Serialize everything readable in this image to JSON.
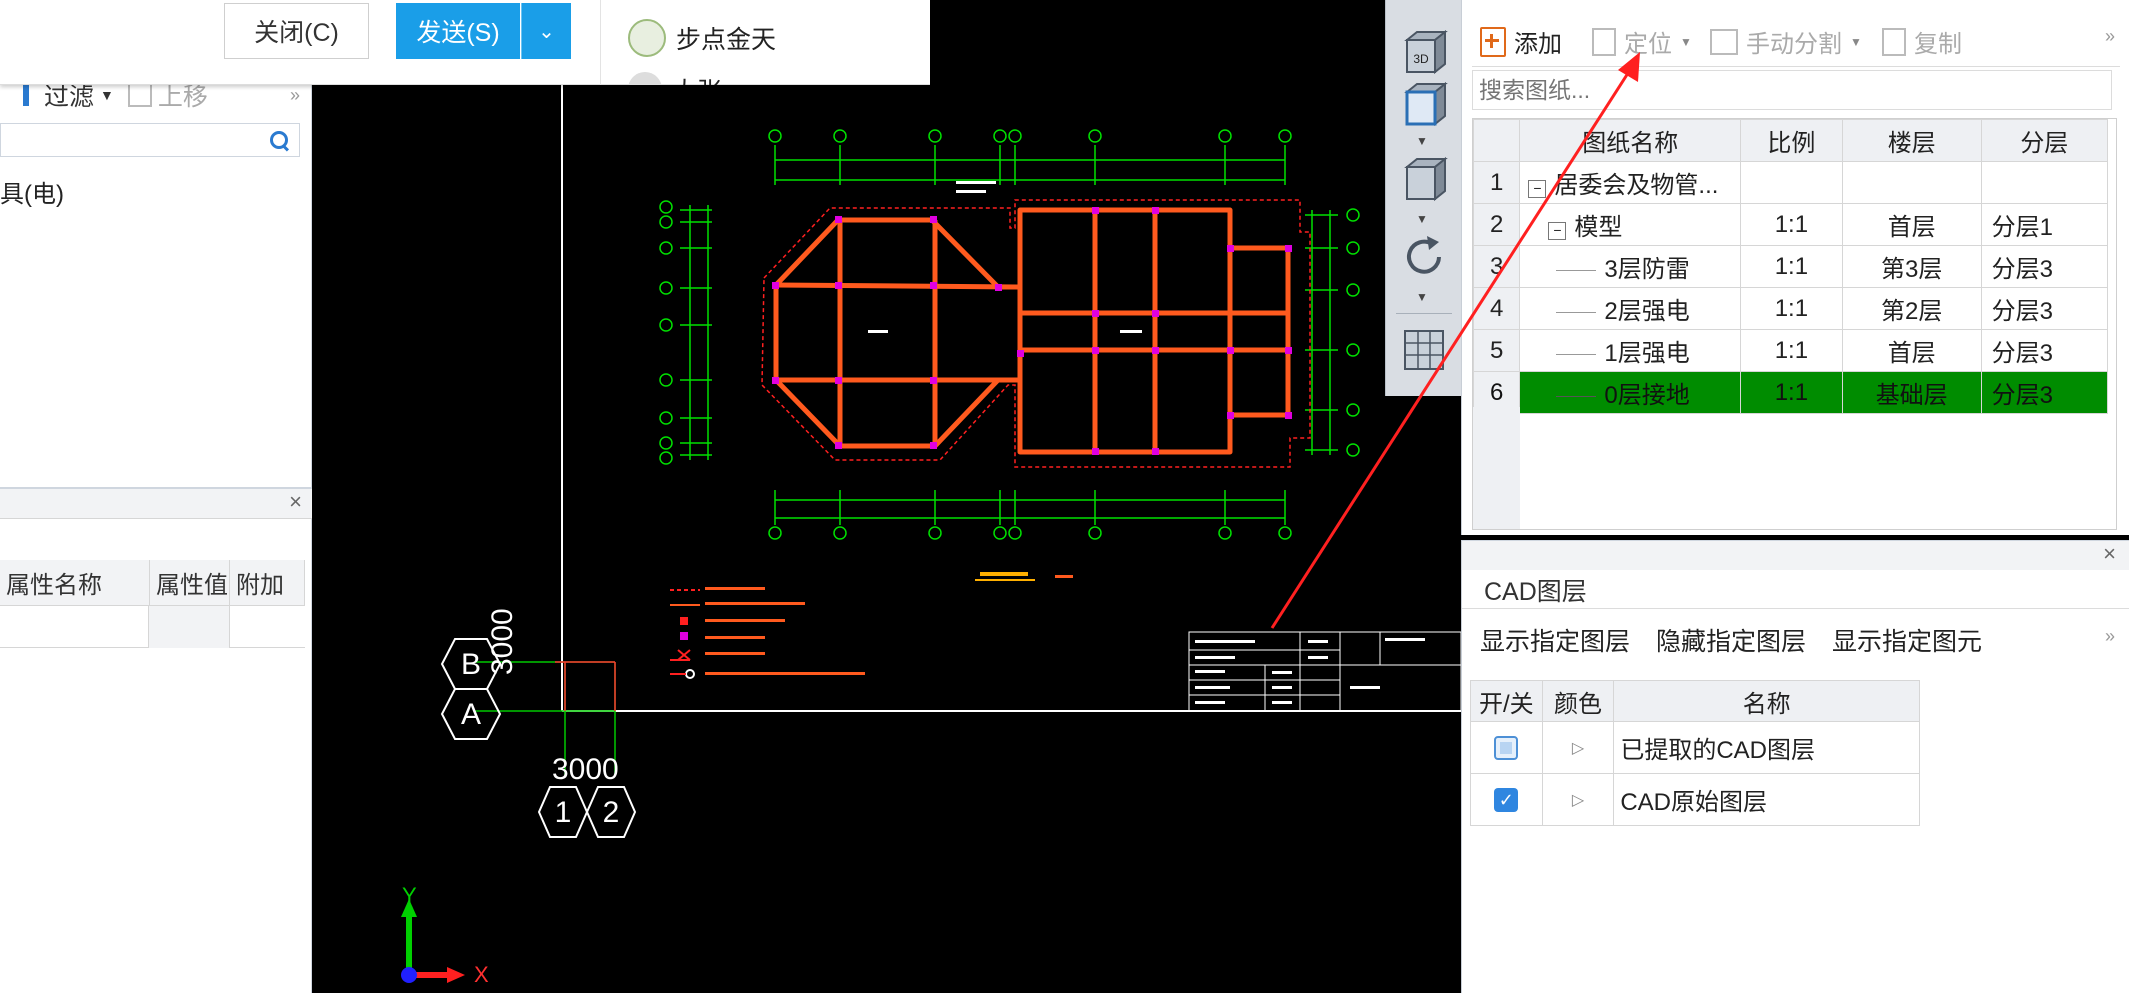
{
  "dialog": {
    "close_label": "关闭(C)",
    "send_label": "发送(S)",
    "contacts": [
      {
        "name": "步点金天"
      },
      {
        "name": "大张"
      }
    ]
  },
  "left_panel": {
    "toolbar": {
      "filter_label": "过滤",
      "moveup_label": "上移"
    },
    "tree_item": "具(电)",
    "properties": {
      "headers": [
        "属性名称",
        "属性值",
        "附加"
      ]
    }
  },
  "canvas": {
    "axis_labels": {
      "row_b": "B",
      "row_a": "A",
      "col_1": "1",
      "col_2": "2",
      "dim_horizontal": "3000",
      "dim_vertical": "3000"
    },
    "ucs": {
      "x_label": "X",
      "y_label": "Y"
    }
  },
  "view_toolbar": {
    "button_3d_label": "3D"
  },
  "drawing_panel": {
    "toolbar": {
      "add_label": "添加",
      "locate_label": "定位",
      "split_label": "手动分割",
      "copy_label": "复制"
    },
    "search_placeholder": "搜索图纸...",
    "columns": [
      "图纸名称",
      "比例",
      "楼层",
      "分层"
    ],
    "rows": [
      {
        "num": "1",
        "name": "居委会及物管...",
        "scale": "",
        "floor": "",
        "layer": ""
      },
      {
        "num": "2",
        "name": "模型",
        "scale": "1:1",
        "floor": "首层",
        "layer": "分层1"
      },
      {
        "num": "3",
        "name": "3层防雷",
        "scale": "1:1",
        "floor": "第3层",
        "layer": "分层3"
      },
      {
        "num": "4",
        "name": "2层强电",
        "scale": "1:1",
        "floor": "第2层",
        "layer": "分层3"
      },
      {
        "num": "5",
        "name": "1层强电",
        "scale": "1:1",
        "floor": "首层",
        "layer": "分层3"
      },
      {
        "num": "6",
        "name": "0层接地",
        "scale": "1:1",
        "floor": "基础层",
        "layer": "分层3"
      }
    ],
    "selected_color": "#008c00"
  },
  "layer_panel": {
    "title": "CAD图层",
    "actions": [
      "显示指定图层",
      "隐藏指定图层",
      "显示指定图元"
    ],
    "columns": [
      "开/关",
      "颜色",
      "名称"
    ],
    "rows": [
      {
        "name": "已提取的CAD图层",
        "checked": false
      },
      {
        "name": "CAD原始图层",
        "checked": true
      }
    ]
  },
  "colors": {
    "accent": "#1a9ee8",
    "cad_green": "#00c800",
    "cad_orange": "#ff5a1e",
    "cad_red": "#ff2020"
  }
}
